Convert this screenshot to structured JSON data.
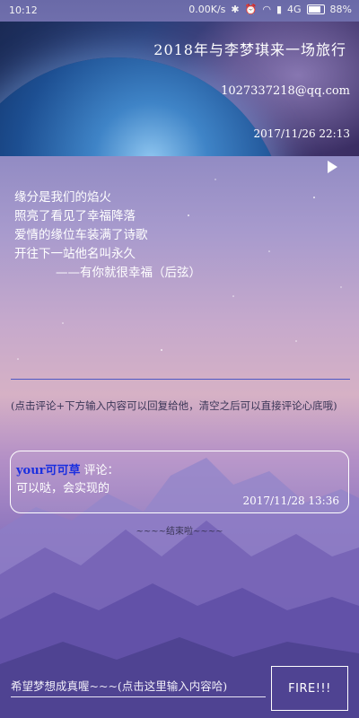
{
  "status": {
    "time": "10:12",
    "speed": "0.00K/s",
    "network": "4G",
    "battery": "88%"
  },
  "header": {
    "title": "2018年与李梦琪来一场旅行",
    "email": "1027337218@qq.com",
    "date": "2017/11/26 22:13"
  },
  "poem": {
    "lines": [
      "缘分是我们的焰火",
      "照亮了看见了幸福降落",
      "爱情的缘位车装满了诗歌",
      "开往下一站他名叫永久"
    ],
    "signature": "——有你就很幸福（后弦）"
  },
  "hint": "(点击评论+下方输入内容可以回复给他，清空之后可以直接评论心底哦)",
  "comment": {
    "user": "your可可草",
    "label": "评论：",
    "content": "可以哒，会实现的",
    "time": "2017/11/28 13:36"
  },
  "end_text": "~~~~结束啦~~~~",
  "input": {
    "placeholder": "希望梦想成真喔~~~(点击这里输入内容哈)"
  },
  "fire_label": "FIRE!!!",
  "colors": {
    "accent_user": "#1a2fe0",
    "divider": "#4d58c5"
  }
}
